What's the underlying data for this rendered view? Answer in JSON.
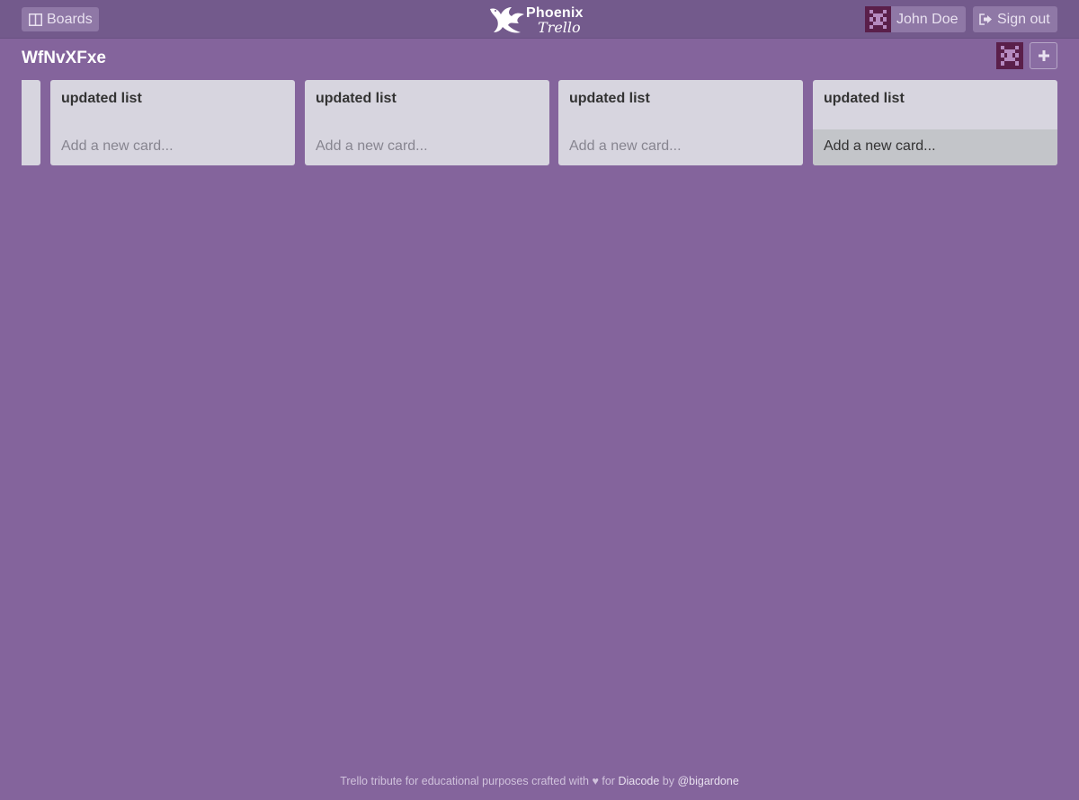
{
  "header": {
    "boards_label": "Boards",
    "logo_line1": "Phoenix",
    "logo_line2": "Trello",
    "user_name": "John Doe",
    "signout_label": "Sign out"
  },
  "board": {
    "title": "WfNvXFxe",
    "lists": [
      {
        "title": "updated list",
        "add_card": "Add a new card..."
      },
      {
        "title": "updated list",
        "add_card": "Add a new card..."
      },
      {
        "title": "updated list",
        "add_card": "Add a new card..."
      },
      {
        "title": "updated list",
        "add_card": "Add a new card..."
      }
    ]
  },
  "footer": {
    "text": "Trello tribute for educational purposes crafted with ♥ for",
    "link1": "Diacode",
    "by": "by",
    "link2": "@bigardone"
  },
  "colors": {
    "background": "#84649c",
    "topbar": "#735a8c",
    "list_bg": "#d7d5df",
    "avatar": "#5a1f4a"
  }
}
